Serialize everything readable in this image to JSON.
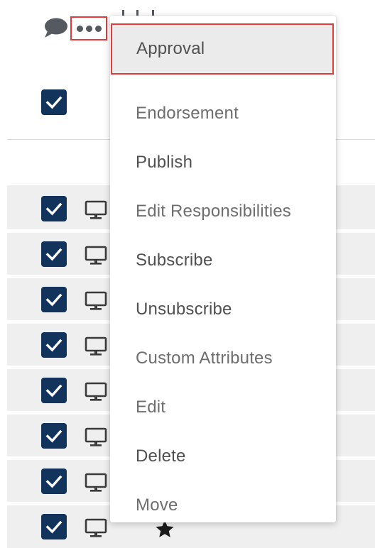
{
  "toolbar": {
    "comment_icon": "speech-bubble-icon",
    "more_icon": "more-horizontal-icon"
  },
  "menu": {
    "items": [
      {
        "label": "Approval",
        "state": "highlighted"
      },
      {
        "label": "Endorsement",
        "state": "normal"
      },
      {
        "label": "Publish",
        "state": "normal"
      },
      {
        "label": "Edit Responsibilities",
        "state": "normal"
      },
      {
        "label": "Subscribe",
        "state": "normal"
      },
      {
        "label": "Unsubscribe",
        "state": "normal"
      },
      {
        "label": "Custom Attributes",
        "state": "normal"
      },
      {
        "label": "Edit",
        "state": "normal"
      },
      {
        "label": "Delete",
        "state": "normal"
      },
      {
        "label": "Move",
        "state": "normal"
      }
    ]
  },
  "table": {
    "header_checkbox": {
      "checked": true
    },
    "rows": [
      {
        "checked": true,
        "type_icon": "monitor-icon",
        "favorite": false
      },
      {
        "checked": true,
        "type_icon": "monitor-icon",
        "favorite": false
      },
      {
        "checked": true,
        "type_icon": "monitor-icon",
        "favorite": false
      },
      {
        "checked": true,
        "type_icon": "monitor-icon",
        "favorite": false
      },
      {
        "checked": true,
        "type_icon": "monitor-icon",
        "favorite": false
      },
      {
        "checked": true,
        "type_icon": "monitor-icon",
        "favorite": false
      },
      {
        "checked": true,
        "type_icon": "monitor-icon",
        "favorite": false
      },
      {
        "checked": true,
        "type_icon": "monitor-icon",
        "favorite": true
      }
    ]
  },
  "colors": {
    "checkbox": "#12335b",
    "highlight_border": "#e23b3b",
    "row_background": "#efefef"
  }
}
